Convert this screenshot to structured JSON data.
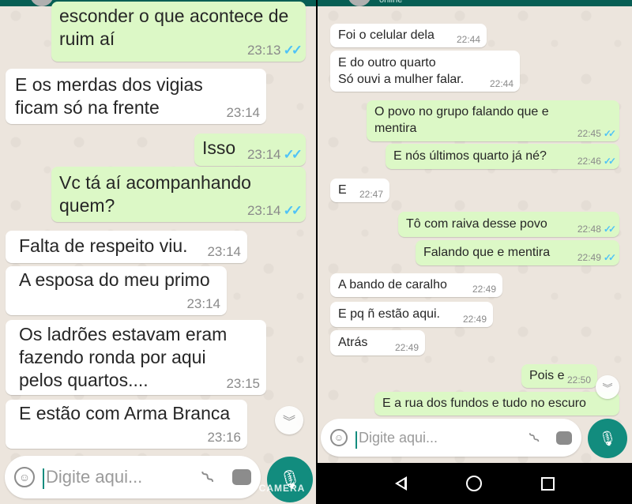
{
  "left": {
    "partial_header_text": "",
    "messages": [
      {
        "dir": "out",
        "text": "esconder o que acontece de\nruim aí",
        "time": "23:13",
        "read": true
      },
      {
        "dir": "in",
        "text": "E os merdas dos vigias\nficam só na frente",
        "time": "23:14"
      },
      {
        "dir": "out",
        "text": "Isso",
        "time": "23:14",
        "read": true
      },
      {
        "dir": "out",
        "text": "Vc tá aí acompanhando\nquem?",
        "time": "23:14",
        "read": true
      },
      {
        "dir": "in",
        "text": "Falta de respeito viu.",
        "time": "23:14"
      },
      {
        "dir": "in",
        "text": "A esposa do meu primo",
        "time": "23:14"
      },
      {
        "dir": "in",
        "text": "Os ladrões estavam eram\nfazendo ronda por aqui\npelos quartos....",
        "time": "23:15"
      },
      {
        "dir": "in",
        "text": "E estão com Arma Branca",
        "time": "23:16"
      }
    ],
    "input_placeholder": "Digite aqui...",
    "watermark": "Z CAMERA"
  },
  "right": {
    "contact_status": "online",
    "messages": [
      {
        "dir": "in",
        "text": "Foi o celular dela",
        "time": "22:44"
      },
      {
        "dir": "in",
        "text": "E do outro quarto\nSó ouvi a mulher falar.",
        "time": "22:44"
      },
      {
        "dir": "out",
        "text": "O povo no grupo falando que e\nmentira",
        "time": "22:45",
        "read": true
      },
      {
        "dir": "out",
        "text": "E nós últimos quarto já né?",
        "time": "22:46",
        "read": true
      },
      {
        "dir": "in",
        "text": "E",
        "time": "22:47"
      },
      {
        "dir": "out",
        "text": "Tô com raiva desse povo",
        "time": "22:48",
        "read": true
      },
      {
        "dir": "out",
        "text": "Falando que e mentira",
        "time": "22:49",
        "read": true
      },
      {
        "dir": "in",
        "text": "A bando de caralho",
        "time": "22:49"
      },
      {
        "dir": "in",
        "text": "E pq ñ estão aqui.",
        "time": "22:49"
      },
      {
        "dir": "in",
        "text": "Atrás",
        "time": "22:49"
      },
      {
        "dir": "out",
        "text": "Pois e",
        "time": "22:50",
        "read": false
      },
      {
        "dir": "out",
        "text": "E a rua dos fundos e tudo no escuro",
        "time": "",
        "read": false
      }
    ],
    "input_placeholder": "Digite aqui..."
  },
  "icons": {
    "emoji": "emoji-icon",
    "attach": "paperclip-icon",
    "camera": "camera-icon",
    "mic": "microphone-icon",
    "scroll": "chevron-down-icon",
    "nav_back": "back-icon",
    "nav_home": "home-icon",
    "nav_recent": "recent-apps-icon"
  },
  "colors": {
    "chat_bg": "#ece5dd",
    "incoming": "#ffffff",
    "outgoing": "#dcf8c6",
    "header": "#075e54",
    "accent": "#128c7e",
    "read_check": "#4fc3f7"
  }
}
